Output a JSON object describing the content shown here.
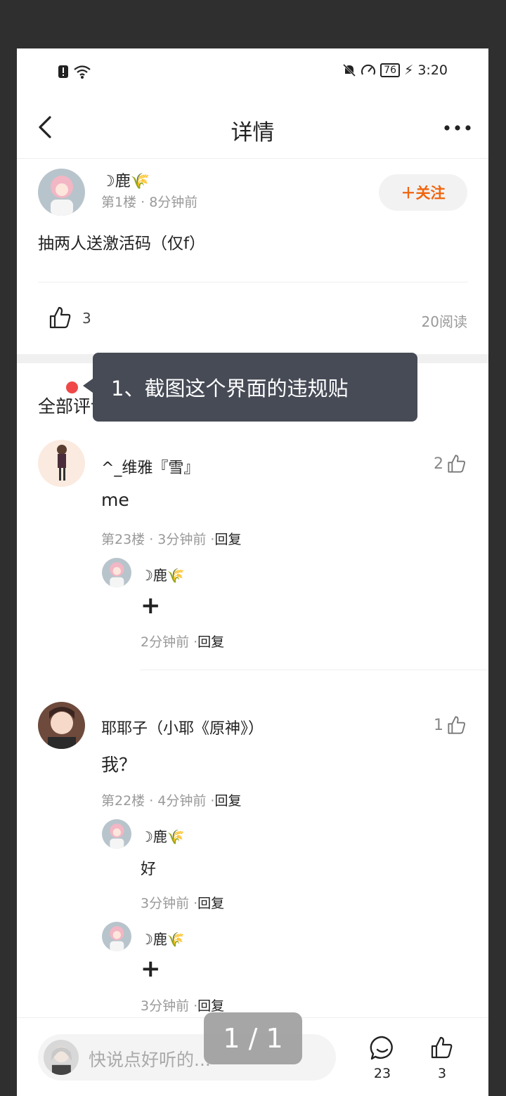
{
  "status": {
    "time": "3:20",
    "battery": "76"
  },
  "nav": {
    "title": "详情"
  },
  "post": {
    "author": "☽鹿🌾",
    "meta": "第1楼 · 8分钟前",
    "follow_label": "＋关注",
    "content": "抽两人送激活码（仅f）",
    "likes": "3",
    "reads": "20阅读"
  },
  "section": {
    "title": "全部评论23"
  },
  "tooltip": {
    "text": "1、截图这个界面的违规贴"
  },
  "comments": [
    {
      "name": "^_维雅『雪』",
      "text": "me",
      "meta": "第23楼 · 3分钟前 ·",
      "reply": "回复",
      "likes": "2",
      "replies": [
        {
          "name": "☽鹿🌾",
          "text": "+",
          "meta": "2分钟前 ·",
          "reply": "回复"
        }
      ]
    },
    {
      "name": "耶耶子（小耶《原神》）",
      "text": "我？",
      "meta": "第22楼 · 4分钟前 ·",
      "reply": "回复",
      "likes": "1",
      "replies": [
        {
          "name": "☽鹿🌾",
          "text": "好",
          "meta": "3分钟前 ·",
          "reply": "回复"
        },
        {
          "name": "☽鹿🌾",
          "text": "+",
          "meta": "3分钟前 ·",
          "reply": "回复"
        }
      ]
    }
  ],
  "bottom": {
    "placeholder": "快说点好听的...",
    "comment_count": "23",
    "like_count": "3"
  },
  "pager": {
    "text": "1 / 1"
  },
  "colors": {
    "accent": "#f0650f",
    "tooltip_bg": "#474b56",
    "red_dot": "#f04848"
  }
}
